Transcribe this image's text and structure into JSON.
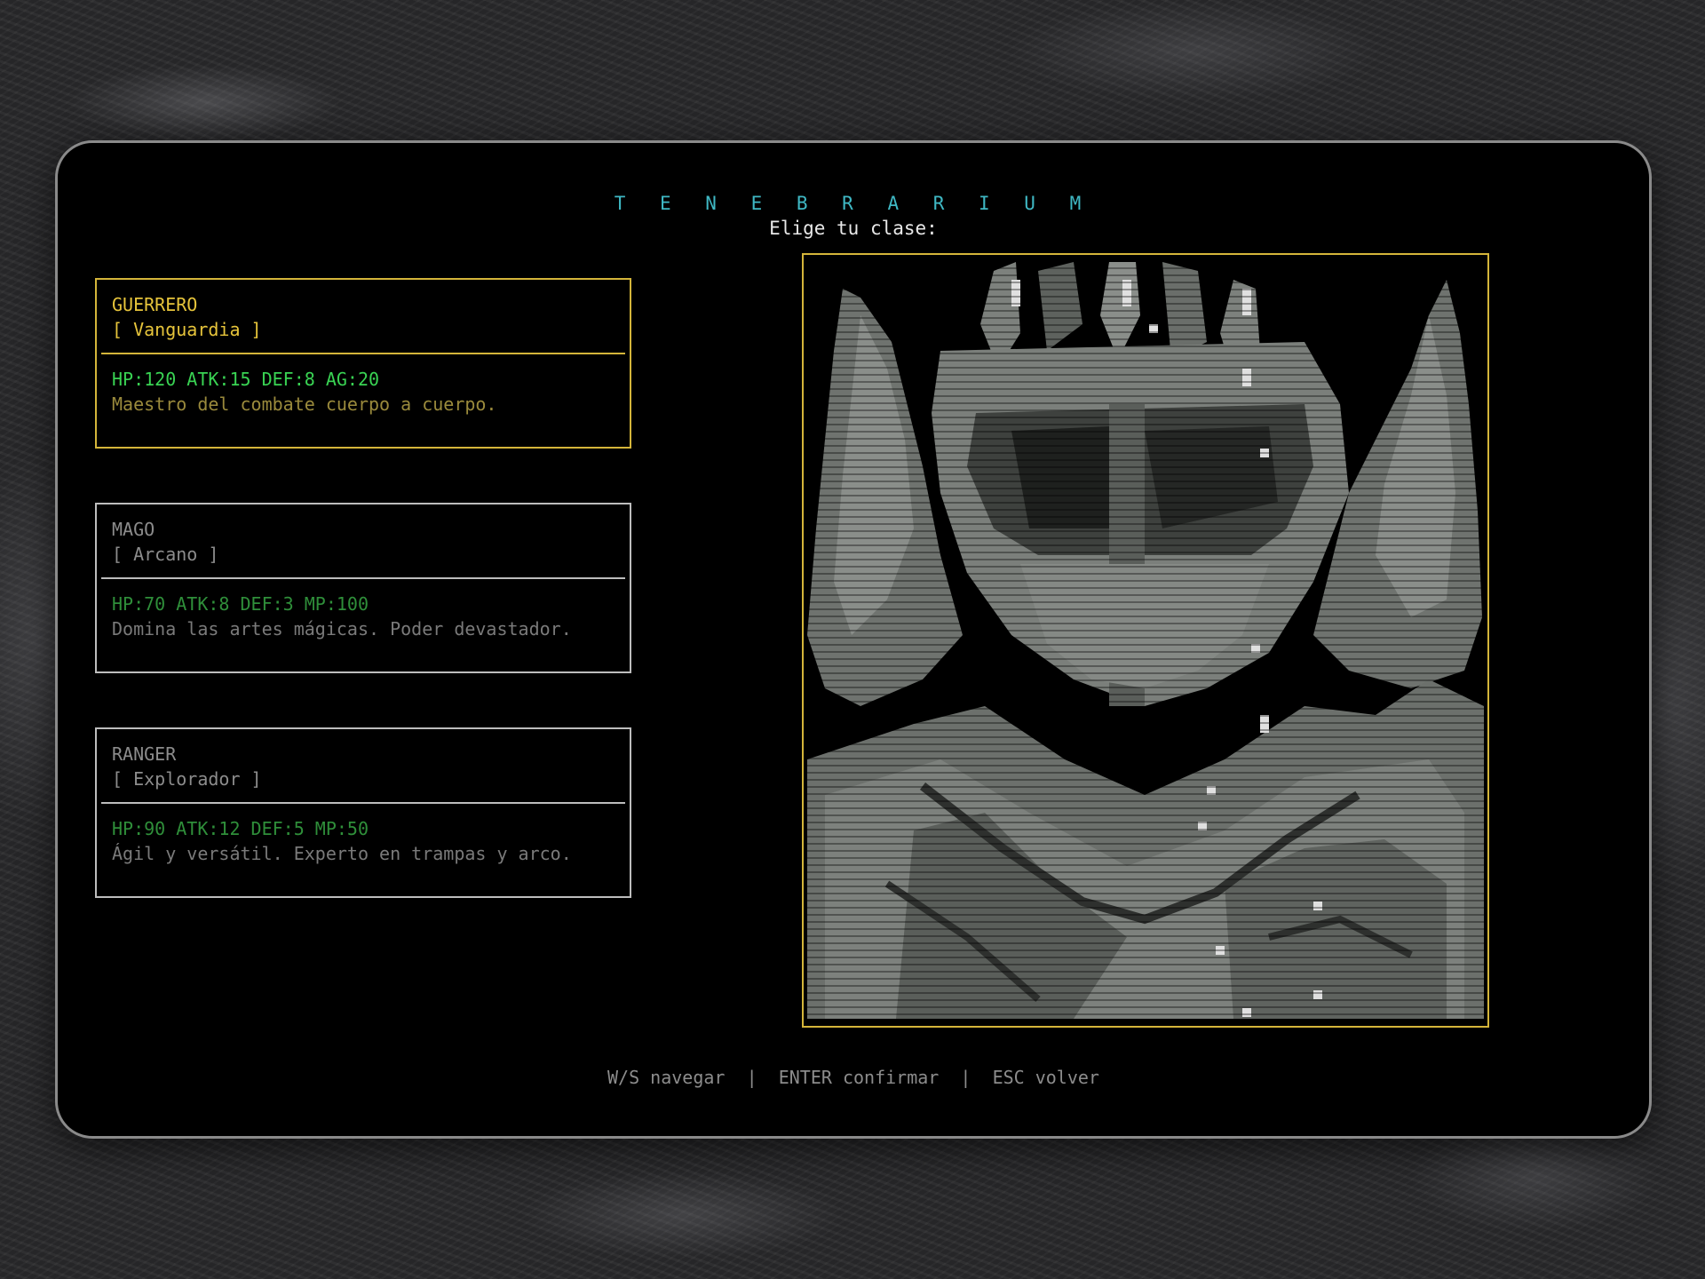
{
  "game": {
    "title": "T E N E B R A R I U M",
    "subtitle": "Elige tu clase:"
  },
  "classes": [
    {
      "name": "GUERRERO",
      "role": "[ Vanguardia ]",
      "stats": "HP:120 ATK:15 DEF:8 AG:20",
      "description": "Maestro del combate cuerpo a cuerpo.",
      "selected": true
    },
    {
      "name": "MAGO",
      "role": "[ Arcano ]",
      "stats": "HP:70 ATK:8 DEF:3 MP:100",
      "description": "Domina las artes mágicas. Poder devastador.",
      "selected": false
    },
    {
      "name": "RANGER",
      "role": "[ Explorador ]",
      "stats": "HP:90 ATK:12 DEF:5 MP:50",
      "description": "Ágil y versátil. Experto en trampas y arco.",
      "selected": false
    }
  ],
  "footer": {
    "navigate": "W/S navegar",
    "confirm": "ENTER confirmar",
    "back": "ESC volver",
    "separator": "|"
  },
  "colors": {
    "accent_title": "#3fb8c4",
    "selected_border": "#d4b53a",
    "stats_green": "#39d353"
  },
  "portrait": {
    "icon": "armored-knight-portrait"
  }
}
